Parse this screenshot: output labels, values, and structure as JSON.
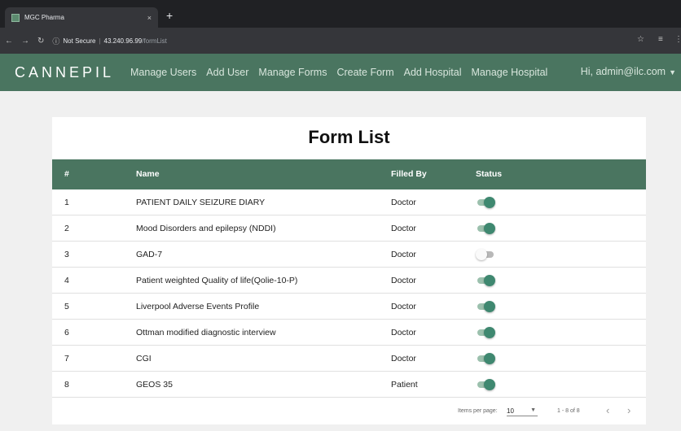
{
  "browser": {
    "tab_title": "MGC Pharma",
    "tab_close": "×",
    "new_tab": "+",
    "security": "Not Secure",
    "url_host": "43.240.96.99",
    "url_path": "/formList"
  },
  "header": {
    "logo": "CANNEPIL",
    "nav": [
      "Manage Users",
      "Add User",
      "Manage Forms",
      "Create Form",
      "Add Hospital",
      "Manage Hospital"
    ],
    "user": "Hi, admin@ilc.com"
  },
  "page": {
    "title": "Form List",
    "columns": {
      "num": "#",
      "name": "Name",
      "filled_by": "Filled By",
      "status": "Status"
    },
    "rows": [
      {
        "num": "1",
        "name": "PATIENT DAILY SEIZURE DIARY",
        "filled_by": "Doctor",
        "status": "on"
      },
      {
        "num": "2",
        "name": "Mood Disorders and epilepsy (NDDI)",
        "filled_by": "Doctor",
        "status": "on"
      },
      {
        "num": "3",
        "name": "GAD-7",
        "filled_by": "Doctor",
        "status": "off"
      },
      {
        "num": "4",
        "name": "Patient weighted Quality of life(Qolie-10-P)",
        "filled_by": "Doctor",
        "status": "on"
      },
      {
        "num": "5",
        "name": "Liverpool Adverse Events Profile",
        "filled_by": "Doctor",
        "status": "on"
      },
      {
        "num": "6",
        "name": "Ottman modified diagnostic interview",
        "filled_by": "Doctor",
        "status": "on"
      },
      {
        "num": "7",
        "name": "CGI",
        "filled_by": "Doctor",
        "status": "on"
      },
      {
        "num": "8",
        "name": "GEOS 35",
        "filled_by": "Patient",
        "status": "on"
      }
    ]
  },
  "paginator": {
    "label": "Items per page:",
    "page_size": "10",
    "range": "1 - 8 of 8"
  },
  "colors": {
    "brand": "#4a7560",
    "toggle_on": "#3f8870"
  }
}
